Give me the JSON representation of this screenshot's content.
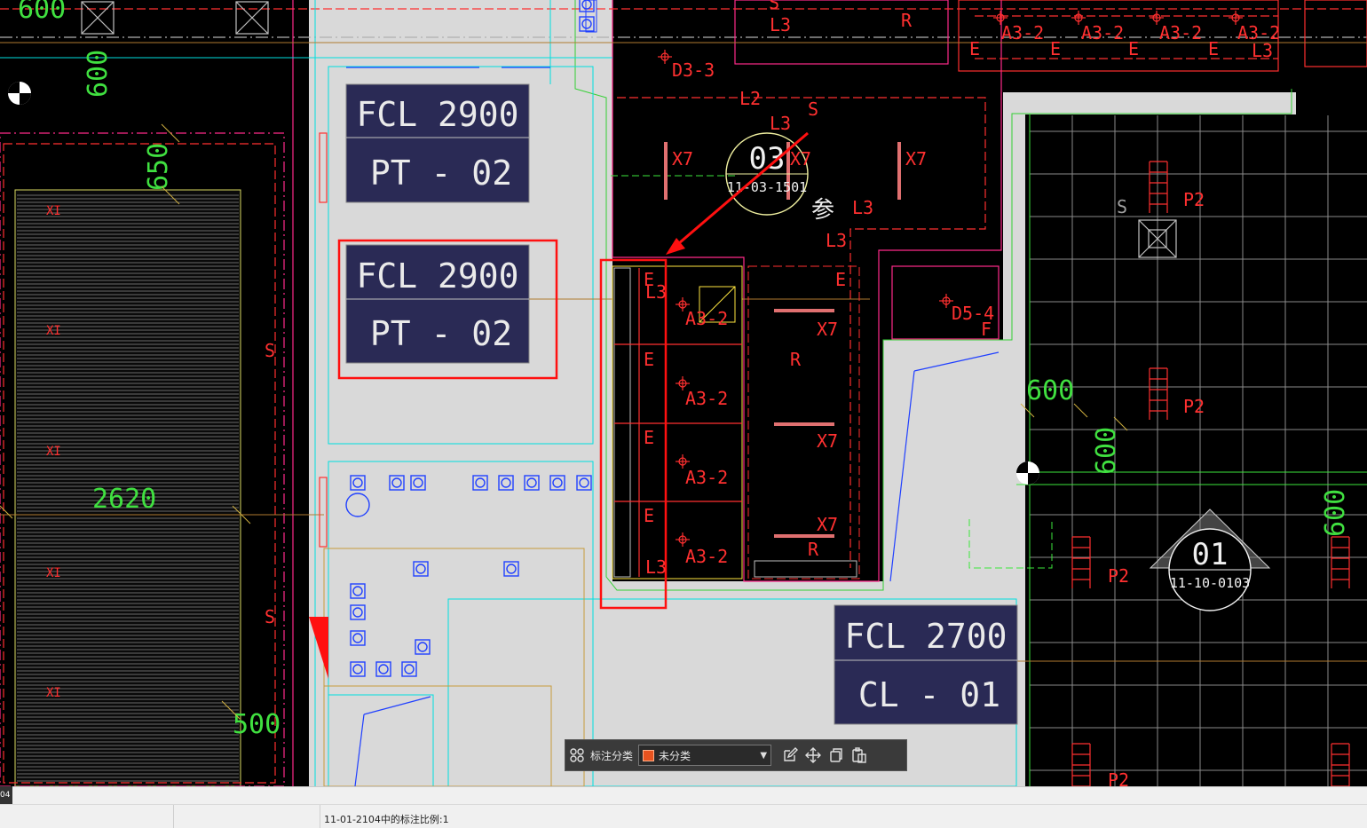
{
  "drawing": {
    "tags": {
      "tag1": {
        "line1": "FCL 2900",
        "line2": "PT - 02"
      },
      "tag2": {
        "line1": "FCL 2900",
        "line2": "PT - 02"
      },
      "tag3": {
        "line1": "FCL 2700",
        "line2": "CL - 01"
      }
    },
    "dimensions": {
      "d600_top": "600",
      "d600_vert": "600",
      "d650": "650",
      "d2620": "2620",
      "d500": "500",
      "d600_right": "600",
      "d600_right2": "600",
      "d600_far": "600"
    },
    "section_markers": {
      "m1": {
        "num": "03",
        "ref": "11-03-1501"
      },
      "m2": {
        "num": "01",
        "ref": "11-10-0103"
      }
    },
    "labels": {
      "d3_3": "D3-3",
      "d5_4": "D5-4",
      "l3_a": "L3",
      "l3_b": "L3",
      "l3_c": "L3",
      "l3_d": "L3",
      "l3_e": "L3",
      "l3_f": "L3",
      "l2": "L2",
      "r_top": "R",
      "r_mid": "R",
      "r_bot": "R",
      "x7_a": "X7",
      "x7_b": "X7",
      "x7_c": "X7",
      "x7_d": "X7",
      "x7_e": "X7",
      "x7_f": "X7",
      "a3_1": "A3-2",
      "a3_2": "A3-2",
      "a3_3": "A3-2",
      "a3_4": "A3-2",
      "a3_t1": "A3-2",
      "a3_t2": "A3-2",
      "a3_t3": "A3-2",
      "a3_t4": "A3-2",
      "e1": "E",
      "e2": "E",
      "e3": "E",
      "e4": "E",
      "e5": "E",
      "e6": "E",
      "e7": "E",
      "e8": "E",
      "e9": "E",
      "e10": "E",
      "s1": "S",
      "s2": "S",
      "s3": "S",
      "s4": "S",
      "s5": "S",
      "p2_1": "P2",
      "p2_2": "P2",
      "p2_3": "P2",
      "p2_4": "P2",
      "can": "参",
      "f1": "F",
      "x1_a": "XI",
      "x1_b": "XI",
      "x1_c": "XI",
      "x1_d": "XI",
      "x1_e": "XI"
    }
  },
  "annotation_bar": {
    "label": "标注分类",
    "category": "未分类",
    "category_color": "#e8531f",
    "icons": [
      "grid-icon",
      "edit-icon",
      "move-icon",
      "copy-icon",
      "paste-icon"
    ]
  },
  "status": {
    "message": "11-01-2104中的标注比例:1",
    "tab_stub": "04"
  }
}
